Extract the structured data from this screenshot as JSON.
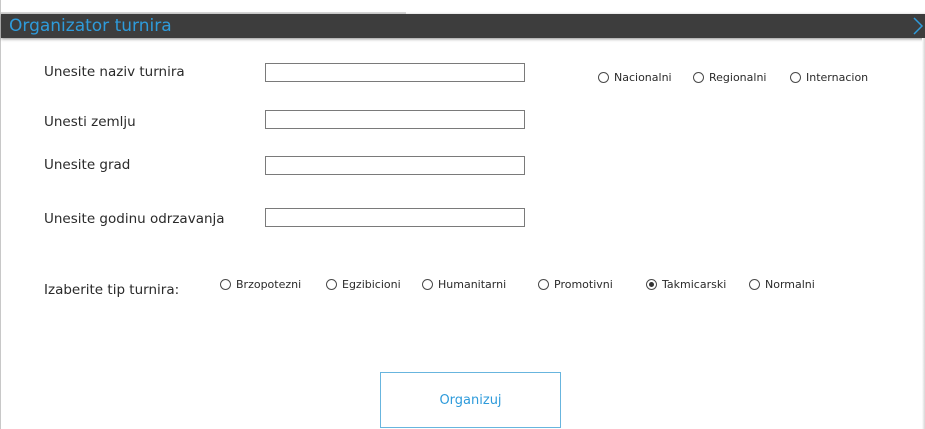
{
  "window": {
    "title": "Organizator turnira",
    "accent_color": "#2e9bdb",
    "titlebar_color": "#3d3d3d",
    "collapse_icon": "chevron-right-icon"
  },
  "form": {
    "naziv_label": "Unesite naziv turnira",
    "naziv_value": "",
    "zemlja_label": "Unesti zemlju",
    "zemlja_value": "",
    "grad_label": "Unesite grad",
    "grad_value": "",
    "godina_label": "Unesite godinu odrzavanja",
    "godina_value": ""
  },
  "scope_options": [
    {
      "label": "Nacionalni",
      "checked": false
    },
    {
      "label": "Regionalni",
      "checked": false
    },
    {
      "label": "Internacion",
      "checked": false
    }
  ],
  "tip": {
    "label": "Izaberite tip turnira:",
    "options": [
      {
        "label": "Brzopotezni",
        "checked": false
      },
      {
        "label": "Egzibicioni",
        "checked": false
      },
      {
        "label": "Humanitarni",
        "checked": false
      },
      {
        "label": "Promotivni",
        "checked": false
      },
      {
        "label": "Takmicarski",
        "checked": true
      },
      {
        "label": "Normalni",
        "checked": false
      }
    ]
  },
  "submit": {
    "label": "Organizuj"
  }
}
